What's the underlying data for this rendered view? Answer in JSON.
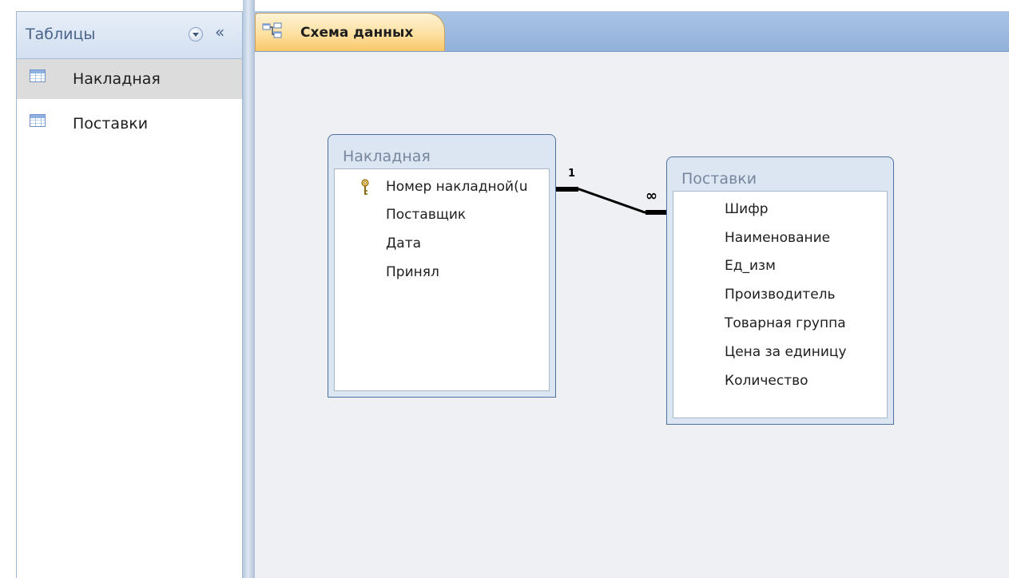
{
  "navigation_pane": {
    "title": "Таблицы",
    "dropdown_icon": "chevron-down-circle-icon",
    "collapse_glyph": "«",
    "items": [
      {
        "label": "Накладная",
        "icon": "table-icon",
        "selected": true
      },
      {
        "label": "Поставки",
        "icon": "table-icon",
        "selected": false
      }
    ]
  },
  "document": {
    "tab": {
      "label": "Схема данных",
      "icon": "relationships-icon"
    }
  },
  "diagram": {
    "tables": [
      {
        "name": "Накладная",
        "fields": [
          {
            "label": "Номер накладной(u",
            "primary_key": true
          },
          {
            "label": "Поставщик",
            "primary_key": false
          },
          {
            "label": "Дата",
            "primary_key": false
          },
          {
            "label": "Принял",
            "primary_key": false
          }
        ]
      },
      {
        "name": "Поставки",
        "fields": [
          {
            "label": "Шифр",
            "primary_key": false
          },
          {
            "label": "Наименование",
            "primary_key": false
          },
          {
            "label": "Ед_изм",
            "primary_key": false
          },
          {
            "label": "Производитель",
            "primary_key": false
          },
          {
            "label": "Товарная группа",
            "primary_key": false
          },
          {
            "label": "Цена за единицу",
            "primary_key": false
          },
          {
            "label": "Количество",
            "primary_key": false
          }
        ]
      }
    ],
    "relationship": {
      "from_table": "Накладная",
      "to_table": "Поставки",
      "one_side_label": "1",
      "many_side_label": "∞"
    }
  },
  "colors": {
    "tab_active": "#fde0a0",
    "tab_bar": "#a9c4e6",
    "canvas_background": "#eef0f4",
    "table_frame": "#dce6f3",
    "selected_row": "#dcdcdc"
  }
}
